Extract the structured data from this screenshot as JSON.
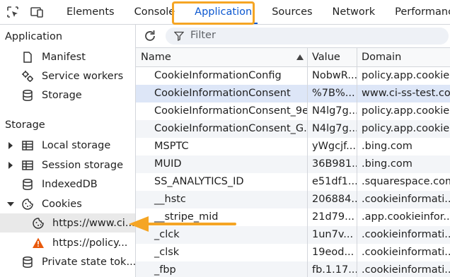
{
  "toolbar": {
    "tabs": [
      {
        "label": "Elements"
      },
      {
        "label": "Console"
      },
      {
        "label": "Application",
        "active": true
      },
      {
        "label": "Sources"
      },
      {
        "label": "Network"
      },
      {
        "label": "Performance"
      }
    ]
  },
  "sidebar": {
    "application_title": "Application",
    "application_items": [
      {
        "label": "Manifest",
        "icon": "document-icon"
      },
      {
        "label": "Service workers",
        "icon": "gears-icon"
      },
      {
        "label": "Storage",
        "icon": "database-icon"
      }
    ],
    "storage_title": "Storage",
    "storage_items": [
      {
        "label": "Local storage",
        "icon": "table-icon",
        "expandable": true
      },
      {
        "label": "Session storage",
        "icon": "table-icon",
        "expandable": true
      },
      {
        "label": "IndexedDB",
        "icon": "database-icon"
      },
      {
        "label": "Cookies",
        "icon": "cookie-icon",
        "expanded": true
      },
      {
        "label": "https://www.ci...",
        "icon": "cookie-icon",
        "selected": true
      },
      {
        "label": "https://policy...",
        "icon": "warning-icon"
      },
      {
        "label": "Private state tok...",
        "icon": "database-icon"
      }
    ]
  },
  "filter": {
    "placeholder": "Filter"
  },
  "table": {
    "headers": {
      "name": "Name",
      "value": "Value",
      "domain": "Domain"
    },
    "rows": [
      {
        "name": "CookieInformationConfig",
        "value": "NobwR...",
        "domain": "policy.app.cookie..."
      },
      {
        "name": "CookieInformationConsent",
        "value": "%7B%...",
        "domain": "www.ci-ss-test.co...",
        "selected": true
      },
      {
        "name": "CookieInformationConsent_9e...",
        "value": "N4lg7g...",
        "domain": "policy.app.cookie..."
      },
      {
        "name": "CookieInformationConsent_G...",
        "value": "N4lg7g...",
        "domain": "policy.app.cookie..."
      },
      {
        "name": "MSPTC",
        "value": "yWgcjf...",
        "domain": ".bing.com"
      },
      {
        "name": "MUID",
        "value": "36B981...",
        "domain": ".bing.com"
      },
      {
        "name": "SS_ANALYTICS_ID",
        "value": "e51df1...",
        "domain": ".squarespace.com"
      },
      {
        "name": "__hstc",
        "value": "206884...",
        "domain": ".cookieinformati..."
      },
      {
        "name": "__stripe_mid",
        "value": "21d79...",
        "domain": ".app.cookieinfor..."
      },
      {
        "name": "_clck",
        "value": "1un7v...",
        "domain": ".cookieinformati..."
      },
      {
        "name": "_clsk",
        "value": "19eod...",
        "domain": ".cookieinformati..."
      },
      {
        "name": "_fbp",
        "value": "fb.1.17...",
        "domain": ".cookieinformati..."
      }
    ]
  },
  "colors": {
    "accent": "#0b57d0",
    "highlight": "#f5a524",
    "selected_row": "#dde6f7"
  }
}
